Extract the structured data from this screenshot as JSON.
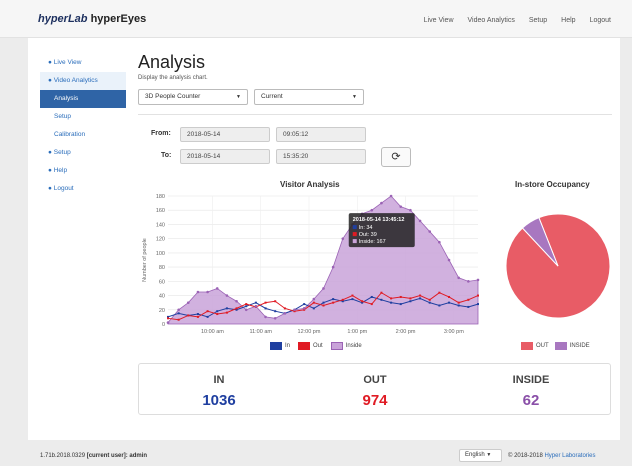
{
  "brand": {
    "part1": "hyperLab",
    "part2": "hyperEyes"
  },
  "topnav": [
    "Live View",
    "Video Analytics",
    "Setup",
    "Help",
    "Logout"
  ],
  "sidebar": {
    "items": [
      {
        "label": "● Live View",
        "state": "normal"
      },
      {
        "label": "● Video Analytics",
        "state": "open"
      },
      {
        "label": "Analysis",
        "state": "active"
      },
      {
        "label": "Setup",
        "state": "sub"
      },
      {
        "label": "Calibration",
        "state": "sub"
      },
      {
        "label": "● Setup",
        "state": "normal"
      },
      {
        "label": "● Help",
        "state": "normal"
      },
      {
        "label": "● Logout",
        "state": "normal"
      }
    ]
  },
  "header": {
    "title": "Analysis",
    "subtitle": "Display the analysis chart."
  },
  "selects": {
    "mode": "3D People Counter",
    "range": "Current"
  },
  "time": {
    "from_label": "From:",
    "from_date": "2018-05-14",
    "from_time": "09:05:12",
    "to_label": "To:",
    "to_date": "2018-05-14",
    "to_time": "15:35:20"
  },
  "refresh_icon": "refresh-icon",
  "colors": {
    "in": "#1f3fa0",
    "out": "#e01b24",
    "inside": "#b07cc6",
    "active": "#2f64a6"
  },
  "chart_data": [
    {
      "type": "area",
      "title": "Visitor Analysis",
      "ylabel": "Number of people",
      "ylim": [
        0,
        180
      ],
      "yticks": [
        0,
        20,
        40,
        60,
        80,
        100,
        120,
        140,
        160,
        180
      ],
      "xtick_labels": [
        "10:00 am",
        "11:00 am",
        "12:00 pm",
        "1:00 pm",
        "2:00 pm",
        "3:00 pm"
      ],
      "xticks_hours": [
        10,
        11,
        12,
        13,
        14,
        15
      ],
      "x_hours": [
        9.08,
        9.3,
        9.5,
        9.7,
        9.9,
        10.1,
        10.3,
        10.5,
        10.7,
        10.9,
        11.1,
        11.3,
        11.5,
        11.7,
        11.9,
        12.1,
        12.3,
        12.5,
        12.7,
        12.9,
        13.1,
        13.3,
        13.5,
        13.7,
        13.9,
        14.1,
        14.3,
        14.5,
        14.7,
        14.9,
        15.1,
        15.3,
        15.5
      ],
      "series": [
        {
          "name": "In",
          "values": [
            10,
            15,
            12,
            14,
            10,
            18,
            22,
            20,
            25,
            30,
            22,
            18,
            15,
            20,
            28,
            22,
            30,
            35,
            32,
            35,
            30,
            38,
            34,
            30,
            28,
            32,
            36,
            30,
            26,
            30,
            26,
            24,
            28
          ]
        },
        {
          "name": "Out",
          "values": [
            8,
            6,
            12,
            10,
            18,
            14,
            16,
            22,
            28,
            24,
            30,
            32,
            22,
            18,
            20,
            30,
            26,
            30,
            34,
            40,
            32,
            28,
            44,
            36,
            38,
            36,
            40,
            34,
            44,
            38,
            30,
            34,
            40
          ]
        },
        {
          "name": "Inside",
          "values": [
            2,
            20,
            30,
            45,
            45,
            50,
            40,
            32,
            20,
            25,
            10,
            8,
            15,
            20,
            22,
            35,
            50,
            80,
            120,
            140,
            155,
            160,
            170,
            180,
            165,
            160,
            145,
            130,
            115,
            90,
            65,
            60,
            62
          ]
        }
      ],
      "annotation": {
        "title": "2018-05-14 13:45:12",
        "lines": [
          "In: 34",
          "Out: 39",
          "Inside: 167"
        ]
      },
      "legend": [
        "In",
        "Out",
        "Inside"
      ]
    },
    {
      "type": "pie",
      "title": "In-store Occupancy",
      "categories": [
        "OUT",
        "INSIDE"
      ],
      "values": [
        974,
        62
      ],
      "legend": [
        "OUT",
        "INSIDE"
      ]
    }
  ],
  "stats": [
    {
      "label": "IN",
      "value": "1036",
      "color": "#1f3fa0"
    },
    {
      "label": "OUT",
      "value": "974",
      "color": "#e01b24"
    },
    {
      "label": "INSIDE",
      "value": "62",
      "color": "#8a4fa8"
    }
  ],
  "footer": {
    "version": "1.71b.2018.0329",
    "user_label": "[current user]:",
    "user": "admin",
    "language": "English",
    "copyright": "© 2018-2018 ",
    "company": "Hyper Laboratories"
  }
}
